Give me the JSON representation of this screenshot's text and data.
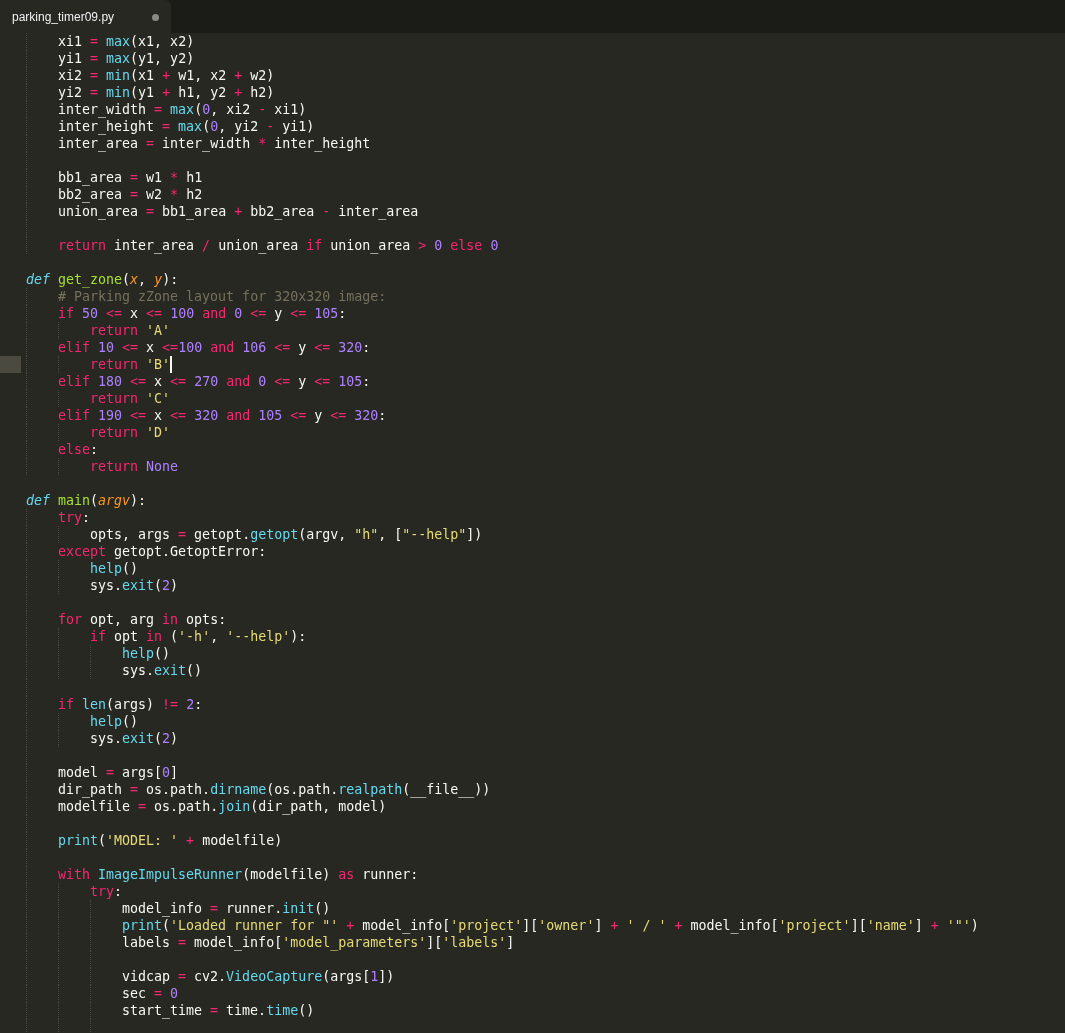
{
  "tab": {
    "label": "parking_timer09.py",
    "selected": true,
    "modified": true
  },
  "lines": [
    {
      "children": [
        {
          "kind": "code",
          "tokens": [
            {
              "kind": "plain",
              "text": "xi1"
            },
            {
              "kind": "keyword",
              "text": " = "
            },
            {
              "kind": "builtin",
              "text": "max"
            },
            {
              "kind": "plain",
              "text": "(x1, x2)"
            }
          ]
        },
        {
          "kind": "code",
          "tokens": [
            {
              "kind": "plain",
              "text": "yi1"
            },
            {
              "kind": "keyword",
              "text": " = "
            },
            {
              "kind": "builtin",
              "text": "max"
            },
            {
              "kind": "plain",
              "text": "(y1, y2)"
            }
          ]
        },
        {
          "kind": "code",
          "tokens": [
            {
              "kind": "plain",
              "text": "xi2"
            },
            {
              "kind": "keyword",
              "text": " = "
            },
            {
              "kind": "builtin",
              "text": "min"
            },
            {
              "kind": "plain",
              "text": "(x1"
            },
            {
              "kind": "keyword",
              "text": " + "
            },
            {
              "kind": "plain",
              "text": "w1, x2"
            },
            {
              "kind": "keyword",
              "text": " + "
            },
            {
              "kind": "plain",
              "text": "w2)"
            }
          ]
        },
        {
          "kind": "code",
          "tokens": [
            {
              "kind": "plain",
              "text": "yi2"
            },
            {
              "kind": "keyword",
              "text": " = "
            },
            {
              "kind": "builtin",
              "text": "min"
            },
            {
              "kind": "plain",
              "text": "(y1"
            },
            {
              "kind": "keyword",
              "text": " + "
            },
            {
              "kind": "plain",
              "text": "h1, y2"
            },
            {
              "kind": "keyword",
              "text": " + "
            },
            {
              "kind": "plain",
              "text": "h2)"
            }
          ]
        },
        {
          "kind": "code",
          "tokens": [
            {
              "kind": "plain",
              "text": "inter_width"
            },
            {
              "kind": "keyword",
              "text": " = "
            },
            {
              "kind": "builtin",
              "text": "max"
            },
            {
              "kind": "plain",
              "text": "("
            },
            {
              "kind": "number",
              "text": "0"
            },
            {
              "kind": "plain",
              "text": ", xi2"
            },
            {
              "kind": "keyword",
              "text": " - "
            },
            {
              "kind": "plain",
              "text": "xi1)"
            }
          ]
        },
        {
          "kind": "code",
          "tokens": [
            {
              "kind": "plain",
              "text": "inter_height"
            },
            {
              "kind": "keyword",
              "text": " = "
            },
            {
              "kind": "builtin",
              "text": "max"
            },
            {
              "kind": "plain",
              "text": "("
            },
            {
              "kind": "number",
              "text": "0"
            },
            {
              "kind": "plain",
              "text": ", yi2"
            },
            {
              "kind": "keyword",
              "text": " - "
            },
            {
              "kind": "plain",
              "text": "yi1)"
            }
          ]
        },
        {
          "kind": "code",
          "tokens": [
            {
              "kind": "plain",
              "text": "inter_area"
            },
            {
              "kind": "keyword",
              "text": " = "
            },
            {
              "kind": "plain",
              "text": "inter_width"
            },
            {
              "kind": "keyword",
              "text": " * "
            },
            {
              "kind": "plain",
              "text": "inter_height"
            }
          ]
        },
        {
          "kind": "blank"
        },
        {
          "kind": "code",
          "tokens": [
            {
              "kind": "plain",
              "text": "bb1_area"
            },
            {
              "kind": "keyword",
              "text": " = "
            },
            {
              "kind": "plain",
              "text": "w1"
            },
            {
              "kind": "keyword",
              "text": " * "
            },
            {
              "kind": "plain",
              "text": "h1"
            }
          ]
        },
        {
          "kind": "code",
          "tokens": [
            {
              "kind": "plain",
              "text": "bb2_area"
            },
            {
              "kind": "keyword",
              "text": " = "
            },
            {
              "kind": "plain",
              "text": "w2"
            },
            {
              "kind": "keyword",
              "text": " * "
            },
            {
              "kind": "plain",
              "text": "h2"
            }
          ]
        },
        {
          "kind": "code",
          "tokens": [
            {
              "kind": "plain",
              "text": "union_area"
            },
            {
              "kind": "keyword",
              "text": " = "
            },
            {
              "kind": "plain",
              "text": "bb1_area"
            },
            {
              "kind": "keyword",
              "text": " + "
            },
            {
              "kind": "plain",
              "text": "bb2_area"
            },
            {
              "kind": "keyword",
              "text": " - "
            },
            {
              "kind": "plain",
              "text": "inter_area"
            }
          ]
        },
        {
          "kind": "blank"
        },
        {
          "kind": "code",
          "tokens": [
            {
              "kind": "keyword",
              "text": "return "
            },
            {
              "kind": "plain",
              "text": "inter_area"
            },
            {
              "kind": "keyword",
              "text": " / "
            },
            {
              "kind": "plain",
              "text": "union_area"
            },
            {
              "kind": "keyword",
              "text": " if "
            },
            {
              "kind": "plain",
              "text": "union_area"
            },
            {
              "kind": "keyword",
              "text": " > "
            },
            {
              "kind": "number",
              "text": "0"
            },
            {
              "kind": "keyword",
              "text": " else "
            },
            {
              "kind": "number",
              "text": "0"
            }
          ]
        }
      ]
    },
    {
      "kind": "blank"
    },
    {
      "kind": "code",
      "tokens": [
        {
          "kind": "storage",
          "text": "def "
        },
        {
          "kind": "function",
          "text": "get_zone"
        },
        {
          "kind": "plain",
          "text": "("
        },
        {
          "kind": "parameter",
          "text": "x"
        },
        {
          "kind": "plain",
          "text": ", "
        },
        {
          "kind": "parameter",
          "text": "y"
        },
        {
          "kind": "plain",
          "text": "):"
        }
      ],
      "children": [
        {
          "kind": "code",
          "tokens": [
            {
              "kind": "comment",
              "text": "# Parking zZone layout for 320x320 image:"
            }
          ]
        },
        {
          "kind": "code",
          "tokens": [
            {
              "kind": "keyword",
              "text": "if "
            },
            {
              "kind": "number",
              "text": "50"
            },
            {
              "kind": "keyword",
              "text": " <= "
            },
            {
              "kind": "plain",
              "text": "x"
            },
            {
              "kind": "keyword",
              "text": " <= "
            },
            {
              "kind": "number",
              "text": "100"
            },
            {
              "kind": "keyword",
              "text": " and "
            },
            {
              "kind": "number",
              "text": "0"
            },
            {
              "kind": "keyword",
              "text": " <= "
            },
            {
              "kind": "plain",
              "text": "y"
            },
            {
              "kind": "keyword",
              "text": " <= "
            },
            {
              "kind": "number",
              "text": "105"
            },
            {
              "kind": "plain",
              "text": ":"
            }
          ],
          "children": [
            {
              "kind": "code",
              "tokens": [
                {
                  "kind": "keyword",
                  "text": "return "
                },
                {
                  "kind": "string",
                  "text": "'A'"
                }
              ]
            }
          ]
        },
        {
          "kind": "code",
          "tokens": [
            {
              "kind": "keyword",
              "text": "elif "
            },
            {
              "kind": "number",
              "text": "10"
            },
            {
              "kind": "keyword",
              "text": " <= "
            },
            {
              "kind": "plain",
              "text": "x"
            },
            {
              "kind": "keyword",
              "text": " <="
            },
            {
              "kind": "number",
              "text": "100"
            },
            {
              "kind": "keyword",
              "text": " and "
            },
            {
              "kind": "number",
              "text": "106"
            },
            {
              "kind": "keyword",
              "text": " <= "
            },
            {
              "kind": "plain",
              "text": "y"
            },
            {
              "kind": "keyword",
              "text": " <= "
            },
            {
              "kind": "number",
              "text": "320"
            },
            {
              "kind": "plain",
              "text": ":"
            }
          ],
          "children": [
            {
              "kind": "code",
              "cursor": true,
              "tokens": [
                {
                  "kind": "keyword",
                  "text": "return "
                },
                {
                  "kind": "string",
                  "text": "'B'"
                }
              ]
            }
          ]
        },
        {
          "kind": "code",
          "tokens": [
            {
              "kind": "keyword",
              "text": "elif "
            },
            {
              "kind": "number",
              "text": "180"
            },
            {
              "kind": "keyword",
              "text": " <= "
            },
            {
              "kind": "plain",
              "text": "x"
            },
            {
              "kind": "keyword",
              "text": " <= "
            },
            {
              "kind": "number",
              "text": "270"
            },
            {
              "kind": "keyword",
              "text": " and "
            },
            {
              "kind": "number",
              "text": "0"
            },
            {
              "kind": "keyword",
              "text": " <= "
            },
            {
              "kind": "plain",
              "text": "y"
            },
            {
              "kind": "keyword",
              "text": " <= "
            },
            {
              "kind": "number",
              "text": "105"
            },
            {
              "kind": "plain",
              "text": ":"
            }
          ],
          "children": [
            {
              "kind": "code",
              "tokens": [
                {
                  "kind": "keyword",
                  "text": "return "
                },
                {
                  "kind": "string",
                  "text": "'C'"
                }
              ]
            }
          ]
        },
        {
          "kind": "code",
          "tokens": [
            {
              "kind": "keyword",
              "text": "elif "
            },
            {
              "kind": "number",
              "text": "190"
            },
            {
              "kind": "keyword",
              "text": " <= "
            },
            {
              "kind": "plain",
              "text": "x"
            },
            {
              "kind": "keyword",
              "text": " <= "
            },
            {
              "kind": "number",
              "text": "320"
            },
            {
              "kind": "keyword",
              "text": " and "
            },
            {
              "kind": "number",
              "text": "105"
            },
            {
              "kind": "keyword",
              "text": " <= "
            },
            {
              "kind": "plain",
              "text": "y"
            },
            {
              "kind": "keyword",
              "text": " <= "
            },
            {
              "kind": "number",
              "text": "320"
            },
            {
              "kind": "plain",
              "text": ":"
            }
          ],
          "children": [
            {
              "kind": "code",
              "tokens": [
                {
                  "kind": "keyword",
                  "text": "return "
                },
                {
                  "kind": "string",
                  "text": "'D'"
                }
              ]
            }
          ]
        },
        {
          "kind": "code",
          "tokens": [
            {
              "kind": "keyword",
              "text": "else"
            },
            {
              "kind": "plain",
              "text": ":"
            }
          ],
          "children": [
            {
              "kind": "code",
              "tokens": [
                {
                  "kind": "keyword",
                  "text": "return "
                },
                {
                  "kind": "number",
                  "text": "None"
                }
              ]
            }
          ]
        }
      ]
    },
    {
      "kind": "blank"
    },
    {
      "kind": "code",
      "tokens": [
        {
          "kind": "storage",
          "text": "def "
        },
        {
          "kind": "function",
          "text": "main"
        },
        {
          "kind": "plain",
          "text": "("
        },
        {
          "kind": "parameter",
          "text": "argv"
        },
        {
          "kind": "plain",
          "text": "):"
        }
      ],
      "children": [
        {
          "kind": "code",
          "tokens": [
            {
              "kind": "keyword",
              "text": "try"
            },
            {
              "kind": "plain",
              "text": ":"
            }
          ],
          "children": [
            {
              "kind": "code",
              "tokens": [
                {
                  "kind": "plain",
                  "text": "opts, args"
                },
                {
                  "kind": "keyword",
                  "text": " = "
                },
                {
                  "kind": "plain",
                  "text": "getopt."
                },
                {
                  "kind": "builtin",
                  "text": "getopt"
                },
                {
                  "kind": "plain",
                  "text": "(argv, "
                },
                {
                  "kind": "string",
                  "text": "\"h\""
                },
                {
                  "kind": "plain",
                  "text": ", ["
                },
                {
                  "kind": "string",
                  "text": "\"--help\""
                },
                {
                  "kind": "plain",
                  "text": "])"
                }
              ]
            }
          ]
        },
        {
          "kind": "code",
          "tokens": [
            {
              "kind": "keyword",
              "text": "except "
            },
            {
              "kind": "plain",
              "text": "getopt.GetoptError:"
            }
          ],
          "children": [
            {
              "kind": "code",
              "tokens": [
                {
                  "kind": "builtin",
                  "text": "help"
                },
                {
                  "kind": "plain",
                  "text": "()"
                }
              ]
            },
            {
              "kind": "code",
              "tokens": [
                {
                  "kind": "plain",
                  "text": "sys."
                },
                {
                  "kind": "builtin",
                  "text": "exit"
                },
                {
                  "kind": "plain",
                  "text": "("
                },
                {
                  "kind": "number",
                  "text": "2"
                },
                {
                  "kind": "plain",
                  "text": ")"
                }
              ]
            }
          ]
        },
        {
          "kind": "blank"
        },
        {
          "kind": "code",
          "tokens": [
            {
              "kind": "keyword",
              "text": "for "
            },
            {
              "kind": "plain",
              "text": "opt, arg"
            },
            {
              "kind": "keyword",
              "text": " in "
            },
            {
              "kind": "plain",
              "text": "opts:"
            }
          ],
          "children": [
            {
              "kind": "code",
              "tokens": [
                {
                  "kind": "keyword",
                  "text": "if "
                },
                {
                  "kind": "plain",
                  "text": "opt"
                },
                {
                  "kind": "keyword",
                  "text": " in "
                },
                {
                  "kind": "plain",
                  "text": "("
                },
                {
                  "kind": "string",
                  "text": "'-h'"
                },
                {
                  "kind": "plain",
                  "text": ", "
                },
                {
                  "kind": "string",
                  "text": "'--help'"
                },
                {
                  "kind": "plain",
                  "text": "):"
                }
              ],
              "children": [
                {
                  "kind": "code",
                  "tokens": [
                    {
                      "kind": "builtin",
                      "text": "help"
                    },
                    {
                      "kind": "plain",
                      "text": "()"
                    }
                  ]
                },
                {
                  "kind": "code",
                  "tokens": [
                    {
                      "kind": "plain",
                      "text": "sys."
                    },
                    {
                      "kind": "builtin",
                      "text": "exit"
                    },
                    {
                      "kind": "plain",
                      "text": "()"
                    }
                  ]
                }
              ]
            }
          ]
        },
        {
          "kind": "blank"
        },
        {
          "kind": "code",
          "tokens": [
            {
              "kind": "keyword",
              "text": "if "
            },
            {
              "kind": "builtin",
              "text": "len"
            },
            {
              "kind": "plain",
              "text": "(args)"
            },
            {
              "kind": "keyword",
              "text": " != "
            },
            {
              "kind": "number",
              "text": "2"
            },
            {
              "kind": "plain",
              "text": ":"
            }
          ],
          "children": [
            {
              "kind": "code",
              "tokens": [
                {
                  "kind": "builtin",
                  "text": "help"
                },
                {
                  "kind": "plain",
                  "text": "()"
                }
              ]
            },
            {
              "kind": "code",
              "tokens": [
                {
                  "kind": "plain",
                  "text": "sys."
                },
                {
                  "kind": "builtin",
                  "text": "exit"
                },
                {
                  "kind": "plain",
                  "text": "("
                },
                {
                  "kind": "number",
                  "text": "2"
                },
                {
                  "kind": "plain",
                  "text": ")"
                }
              ]
            }
          ]
        },
        {
          "kind": "blank"
        },
        {
          "kind": "code",
          "tokens": [
            {
              "kind": "plain",
              "text": "model"
            },
            {
              "kind": "keyword",
              "text": " = "
            },
            {
              "kind": "plain",
              "text": "args["
            },
            {
              "kind": "number",
              "text": "0"
            },
            {
              "kind": "plain",
              "text": "]"
            }
          ]
        },
        {
          "kind": "code",
          "tokens": [
            {
              "kind": "plain",
              "text": "dir_path"
            },
            {
              "kind": "keyword",
              "text": " = "
            },
            {
              "kind": "plain",
              "text": "os.path."
            },
            {
              "kind": "builtin",
              "text": "dirname"
            },
            {
              "kind": "plain",
              "text": "(os.path."
            },
            {
              "kind": "builtin",
              "text": "realpath"
            },
            {
              "kind": "plain",
              "text": "(__file__))"
            }
          ]
        },
        {
          "kind": "code",
          "tokens": [
            {
              "kind": "plain",
              "text": "modelfile"
            },
            {
              "kind": "keyword",
              "text": " = "
            },
            {
              "kind": "plain",
              "text": "os.path."
            },
            {
              "kind": "builtin",
              "text": "join"
            },
            {
              "kind": "plain",
              "text": "(dir_path, model)"
            }
          ]
        },
        {
          "kind": "blank"
        },
        {
          "kind": "code",
          "tokens": [
            {
              "kind": "builtin",
              "text": "print"
            },
            {
              "kind": "plain",
              "text": "("
            },
            {
              "kind": "string",
              "text": "'MODEL: '"
            },
            {
              "kind": "keyword",
              "text": " + "
            },
            {
              "kind": "plain",
              "text": "modelfile)"
            }
          ]
        },
        {
          "kind": "blank"
        },
        {
          "kind": "code",
          "tokens": [
            {
              "kind": "keyword",
              "text": "with "
            },
            {
              "kind": "builtin",
              "text": "ImageImpulseRunner"
            },
            {
              "kind": "plain",
              "text": "(modelfile)"
            },
            {
              "kind": "keyword",
              "text": " as "
            },
            {
              "kind": "plain",
              "text": "runner:"
            }
          ],
          "children": [
            {
              "kind": "code",
              "tokens": [
                {
                  "kind": "keyword",
                  "text": "try"
                },
                {
                  "kind": "plain",
                  "text": ":"
                }
              ],
              "children": [
                {
                  "kind": "code",
                  "tokens": [
                    {
                      "kind": "plain",
                      "text": "model_info"
                    },
                    {
                      "kind": "keyword",
                      "text": " = "
                    },
                    {
                      "kind": "plain",
                      "text": "runner."
                    },
                    {
                      "kind": "builtin",
                      "text": "init"
                    },
                    {
                      "kind": "plain",
                      "text": "()"
                    }
                  ]
                },
                {
                  "kind": "code",
                  "tokens": [
                    {
                      "kind": "builtin",
                      "text": "print"
                    },
                    {
                      "kind": "plain",
                      "text": "("
                    },
                    {
                      "kind": "string",
                      "text": "'Loaded runner for \"'"
                    },
                    {
                      "kind": "keyword",
                      "text": " + "
                    },
                    {
                      "kind": "plain",
                      "text": "model_info["
                    },
                    {
                      "kind": "string",
                      "text": "'project'"
                    },
                    {
                      "kind": "plain",
                      "text": "]["
                    },
                    {
                      "kind": "string",
                      "text": "'owner'"
                    },
                    {
                      "kind": "plain",
                      "text": "]"
                    },
                    {
                      "kind": "keyword",
                      "text": " + "
                    },
                    {
                      "kind": "string",
                      "text": "' / '"
                    },
                    {
                      "kind": "keyword",
                      "text": " + "
                    },
                    {
                      "kind": "plain",
                      "text": "model_info["
                    },
                    {
                      "kind": "string",
                      "text": "'project'"
                    },
                    {
                      "kind": "plain",
                      "text": "]["
                    },
                    {
                      "kind": "string",
                      "text": "'name'"
                    },
                    {
                      "kind": "plain",
                      "text": "]"
                    },
                    {
                      "kind": "keyword",
                      "text": " + "
                    },
                    {
                      "kind": "string",
                      "text": "'\"'"
                    },
                    {
                      "kind": "plain",
                      "text": ")"
                    }
                  ]
                },
                {
                  "kind": "code",
                  "tokens": [
                    {
                      "kind": "plain",
                      "text": "labels"
                    },
                    {
                      "kind": "keyword",
                      "text": " = "
                    },
                    {
                      "kind": "plain",
                      "text": "model_info["
                    },
                    {
                      "kind": "string",
                      "text": "'model_parameters'"
                    },
                    {
                      "kind": "plain",
                      "text": "]["
                    },
                    {
                      "kind": "string",
                      "text": "'labels'"
                    },
                    {
                      "kind": "plain",
                      "text": "]"
                    }
                  ]
                },
                {
                  "kind": "blank"
                },
                {
                  "kind": "code",
                  "tokens": [
                    {
                      "kind": "plain",
                      "text": "vidcap"
                    },
                    {
                      "kind": "keyword",
                      "text": " = "
                    },
                    {
                      "kind": "plain",
                      "text": "cv2."
                    },
                    {
                      "kind": "builtin",
                      "text": "VideoCapture"
                    },
                    {
                      "kind": "plain",
                      "text": "(args["
                    },
                    {
                      "kind": "number",
                      "text": "1"
                    },
                    {
                      "kind": "plain",
                      "text": "])"
                    }
                  ]
                },
                {
                  "kind": "code",
                  "tokens": [
                    {
                      "kind": "plain",
                      "text": "sec"
                    },
                    {
                      "kind": "keyword",
                      "text": " = "
                    },
                    {
                      "kind": "number",
                      "text": "0"
                    }
                  ]
                },
                {
                  "kind": "code",
                  "tokens": [
                    {
                      "kind": "plain",
                      "text": "start_time"
                    },
                    {
                      "kind": "keyword",
                      "text": " = "
                    },
                    {
                      "kind": "plain",
                      "text": "time."
                    },
                    {
                      "kind": "builtin",
                      "text": "time"
                    },
                    {
                      "kind": "plain",
                      "text": "()"
                    }
                  ]
                },
                {
                  "kind": "blank"
                }
              ]
            }
          ]
        }
      ]
    }
  ]
}
